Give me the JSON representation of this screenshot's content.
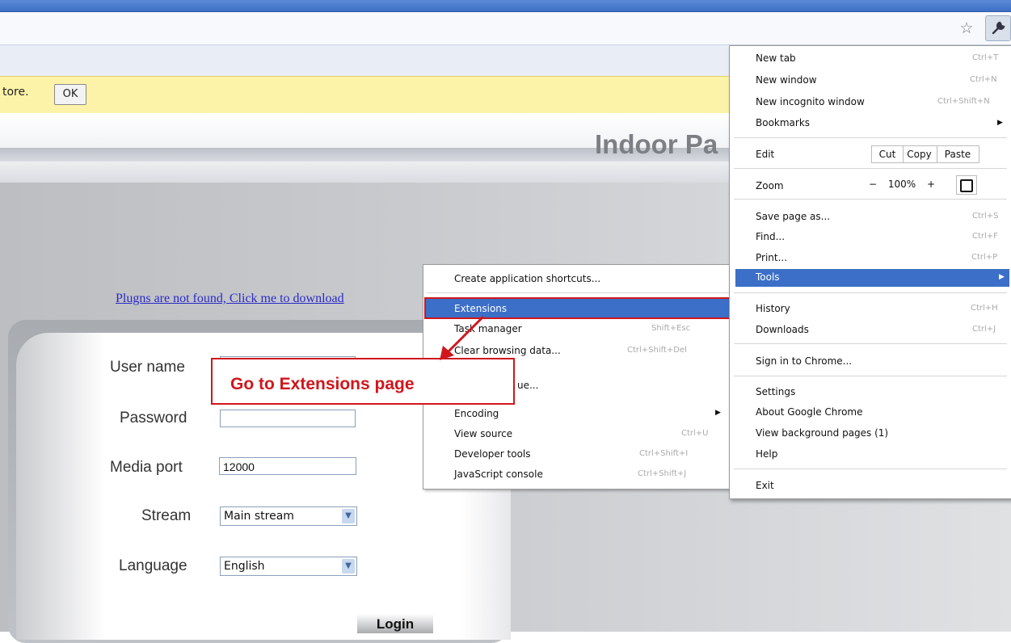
{
  "browser": {
    "star_glyph": "☆",
    "wrench_glyph": "🔧",
    "infobar": {
      "text": "tore.",
      "ok_label": "OK"
    }
  },
  "page": {
    "title": "Indoor Pa",
    "plugin_link": "Plugns are not found, Click me to download",
    "login": {
      "username_label": "User name",
      "password_label": "Password",
      "media_port_label": "Media port",
      "media_port_value": "12000",
      "stream_label": "Stream",
      "stream_value": "Main stream",
      "language_label": "Language",
      "language_value": "English",
      "login_button": "Login"
    }
  },
  "chrome_menu": {
    "new_tab": "New tab",
    "new_tab_sc": "Ctrl+T",
    "new_window": "New window",
    "new_window_sc": "Ctrl+N",
    "incognito": "New incognito window",
    "incognito_sc": "Ctrl+Shift+N",
    "bookmarks": "Bookmarks",
    "edit": "Edit",
    "cut": "Cut",
    "copy": "Copy",
    "paste": "Paste",
    "zoom": "Zoom",
    "zoom_minus": "−",
    "zoom_value": "100%",
    "zoom_plus": "+",
    "save_page": "Save page as...",
    "save_page_sc": "Ctrl+S",
    "find": "Find...",
    "find_sc": "Ctrl+F",
    "print": "Print...",
    "print_sc": "Ctrl+P",
    "tools": "Tools",
    "history": "History",
    "history_sc": "Ctrl+H",
    "downloads": "Downloads",
    "downloads_sc": "Ctrl+J",
    "sign_in": "Sign in to Chrome...",
    "settings": "Settings",
    "about": "About Google Chrome",
    "background_pages": "View background pages (1)",
    "help": "Help",
    "exit": "Exit"
  },
  "tools_menu": {
    "create_shortcuts": "Create application shortcuts...",
    "extensions": "Extensions",
    "task_manager": "Task manager",
    "task_manager_sc": "Shift+Esc",
    "clear_browsing": "Clear browsing data...",
    "clear_browsing_sc": "Ctrl+Shift+Del",
    "report_issue_fragment": "ue...",
    "encoding": "Encoding",
    "view_source": "View source",
    "view_source_sc": "Ctrl+U",
    "developer_tools": "Developer tools",
    "developer_tools_sc": "Ctrl+Shift+I",
    "js_console": "JavaScript console",
    "js_console_sc": "Ctrl+Shift+J"
  },
  "annotation": {
    "callout_text": "Go to Extensions page",
    "accent_color": "#d0161c"
  }
}
